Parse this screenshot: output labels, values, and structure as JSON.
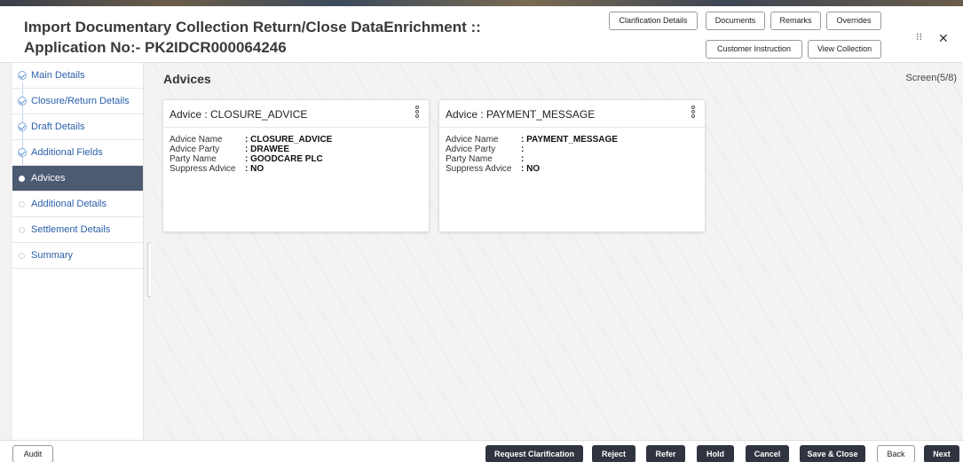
{
  "header": {
    "title_line1": "Import Documentary Collection Return/Close DataEnrichment ::",
    "title_line2": "Application No:- PK2IDCR000064246",
    "buttons": {
      "clarification": "Clarification Details",
      "documents": "Documents",
      "remarks": "Remarks",
      "overrides": "Overrides",
      "customer_instruction": "Customer Instruction",
      "view_collection": "View Collection"
    },
    "minimize_icon": "⁝⁝",
    "close_icon": "✕"
  },
  "sidebar": {
    "items": [
      {
        "label": "Main Details",
        "state": "done"
      },
      {
        "label": "Closure/Return Details",
        "state": "done"
      },
      {
        "label": "Draft Details",
        "state": "done"
      },
      {
        "label": "Additional Fields",
        "state": "done"
      },
      {
        "label": "Advices",
        "state": "active"
      },
      {
        "label": "Additional Details",
        "state": "pending"
      },
      {
        "label": "Settlement Details",
        "state": "pending"
      },
      {
        "label": "Summary",
        "state": "pending"
      }
    ]
  },
  "main": {
    "section_title": "Advices",
    "screen_label": "Screen(5/8)",
    "field_labels": {
      "advice_name": "Advice Name",
      "advice_party": "Advice Party",
      "party_name": "Party Name",
      "suppress_advice": "Suppress Advice"
    },
    "cards": [
      {
        "title": "Advice : CLOSURE_ADVICE",
        "advice_name": ": CLOSURE_ADVICE",
        "advice_party": ": DRAWEE",
        "party_name": ": GOODCARE PLC",
        "suppress_advice": ": NO"
      },
      {
        "title": "Advice : PAYMENT_MESSAGE",
        "advice_name": ": PAYMENT_MESSAGE",
        "advice_party": ":",
        "party_name": ":",
        "suppress_advice": ": NO"
      }
    ]
  },
  "footer": {
    "audit": "Audit",
    "request_clarification": "Request Clarification",
    "reject": "Reject",
    "refer": "Refer",
    "hold": "Hold",
    "cancel": "Cancel",
    "save_close": "Save & Close",
    "back": "Back",
    "next": "Next"
  }
}
